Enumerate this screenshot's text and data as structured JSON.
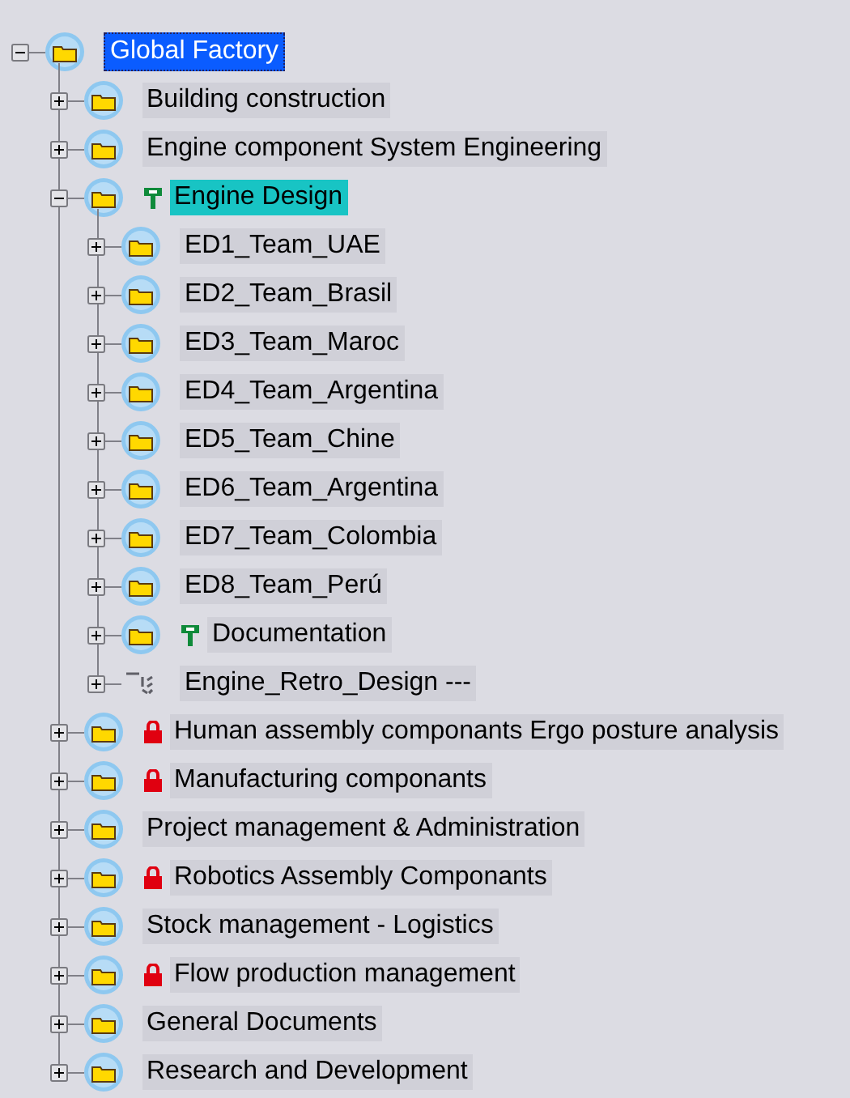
{
  "tree": [
    {
      "label": "Global Factory",
      "kind": "folder",
      "locked": false,
      "reserved": false,
      "expanded": true,
      "selected": true,
      "highlighted": false,
      "children": [
        {
          "label": "Building construction",
          "kind": "folder",
          "locked": false,
          "reserved": false,
          "expanded": false,
          "selected": false,
          "highlighted": false
        },
        {
          "label": "Engine component System Engineering",
          "kind": "folder",
          "locked": false,
          "reserved": false,
          "expanded": false,
          "selected": false,
          "highlighted": false
        },
        {
          "label": "Engine Design",
          "kind": "folder",
          "locked": false,
          "reserved": true,
          "expanded": true,
          "selected": false,
          "highlighted": true,
          "children": [
            {
              "label": "ED1_Team_UAE",
              "kind": "folder",
              "locked": false,
              "reserved": false,
              "expanded": false,
              "selected": false,
              "highlighted": false
            },
            {
              "label": "ED2_Team_Brasil",
              "kind": "folder",
              "locked": false,
              "reserved": false,
              "expanded": false,
              "selected": false,
              "highlighted": false
            },
            {
              "label": "ED3_Team_Maroc",
              "kind": "folder",
              "locked": false,
              "reserved": false,
              "expanded": false,
              "selected": false,
              "highlighted": false
            },
            {
              "label": "ED4_Team_Argentina",
              "kind": "folder",
              "locked": false,
              "reserved": false,
              "expanded": false,
              "selected": false,
              "highlighted": false
            },
            {
              "label": "ED5_Team_Chine",
              "kind": "folder",
              "locked": false,
              "reserved": false,
              "expanded": false,
              "selected": false,
              "highlighted": false
            },
            {
              "label": "ED6_Team_Argentina",
              "kind": "folder",
              "locked": false,
              "reserved": false,
              "expanded": false,
              "selected": false,
              "highlighted": false
            },
            {
              "label": "ED7_Team_Colombia",
              "kind": "folder",
              "locked": false,
              "reserved": false,
              "expanded": false,
              "selected": false,
              "highlighted": false
            },
            {
              "label": "ED8_Team_Perú",
              "kind": "folder",
              "locked": false,
              "reserved": false,
              "expanded": false,
              "selected": false,
              "highlighted": false
            },
            {
              "label": "Documentation",
              "kind": "folder",
              "locked": false,
              "reserved": true,
              "expanded": false,
              "selected": false,
              "highlighted": false
            },
            {
              "label": "Engine_Retro_Design ---",
              "kind": "link",
              "locked": false,
              "reserved": false,
              "expanded": false,
              "selected": false,
              "highlighted": false
            }
          ]
        },
        {
          "label": "Human assembly componants Ergo posture analysis",
          "kind": "folder",
          "locked": true,
          "reserved": false,
          "expanded": false,
          "selected": false,
          "highlighted": false
        },
        {
          "label": "Manufacturing componants",
          "kind": "folder",
          "locked": true,
          "reserved": false,
          "expanded": false,
          "selected": false,
          "highlighted": false
        },
        {
          "label": "Project management & Administration",
          "kind": "folder",
          "locked": false,
          "reserved": false,
          "expanded": false,
          "selected": false,
          "highlighted": false
        },
        {
          "label": "Robotics Assembly Componants",
          "kind": "folder",
          "locked": true,
          "reserved": false,
          "expanded": false,
          "selected": false,
          "highlighted": false
        },
        {
          "label": "Stock management - Logistics",
          "kind": "folder",
          "locked": false,
          "reserved": false,
          "expanded": false,
          "selected": false,
          "highlighted": false
        },
        {
          "label": "Flow production management",
          "kind": "folder",
          "locked": true,
          "reserved": false,
          "expanded": false,
          "selected": false,
          "highlighted": false
        },
        {
          "label": "General Documents",
          "kind": "folder",
          "locked": false,
          "reserved": false,
          "expanded": false,
          "selected": false,
          "highlighted": false
        },
        {
          "label": "Research and Development",
          "kind": "folder",
          "locked": false,
          "reserved": false,
          "expanded": false,
          "selected": false,
          "highlighted": false
        }
      ]
    }
  ]
}
